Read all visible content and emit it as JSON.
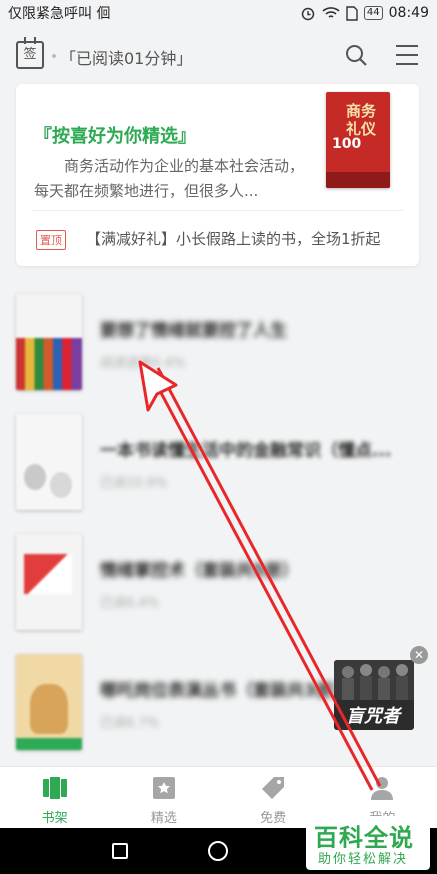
{
  "status_bar": {
    "left_text": "仅限紧急呼叫 佪",
    "battery": "44",
    "time": "08:49"
  },
  "header": {
    "sign_icon_char": "签",
    "read_time": "「已阅读01分钟」"
  },
  "feature": {
    "title": "『按喜好为你精选』",
    "description": "商务活动作为企业的基本社会活动，每天都在频繁地进行，但很多人...",
    "cover_title": "商务礼仪",
    "cover_num": "100",
    "promo_badge": "置顶",
    "promo_text": "【满减好礼】小长假路上读的书，全场1折起"
  },
  "books": [
    {
      "title": "要想了情绪就要控了人生",
      "progress": "阅读进度0.4%"
    },
    {
      "title": "一本书读懂生活中的金融常识（懂点...",
      "progress": "已读10.9%"
    },
    {
      "title": "情绪掌控术（套装共5册）",
      "progress": "已读6.4%"
    },
    {
      "title": "哪吒岗位表演丛书（套装共3册）",
      "progress": "已读6.7%"
    }
  ],
  "float_ad": {
    "title": "盲咒者"
  },
  "bottom_nav": [
    {
      "label": "书架",
      "icon": "bookshelf-icon",
      "active": true
    },
    {
      "label": "精选",
      "icon": "star-book-icon",
      "active": false
    },
    {
      "label": "免费",
      "icon": "tag-icon",
      "active": false
    },
    {
      "label": "我的",
      "icon": "user-icon",
      "active": false
    }
  ],
  "watermark": {
    "main": "百科全说",
    "sub": "助你轻松解决"
  },
  "colors": {
    "accent": "#2eaa55",
    "annotation": "#e8272a",
    "promo": "#e25a4c"
  }
}
